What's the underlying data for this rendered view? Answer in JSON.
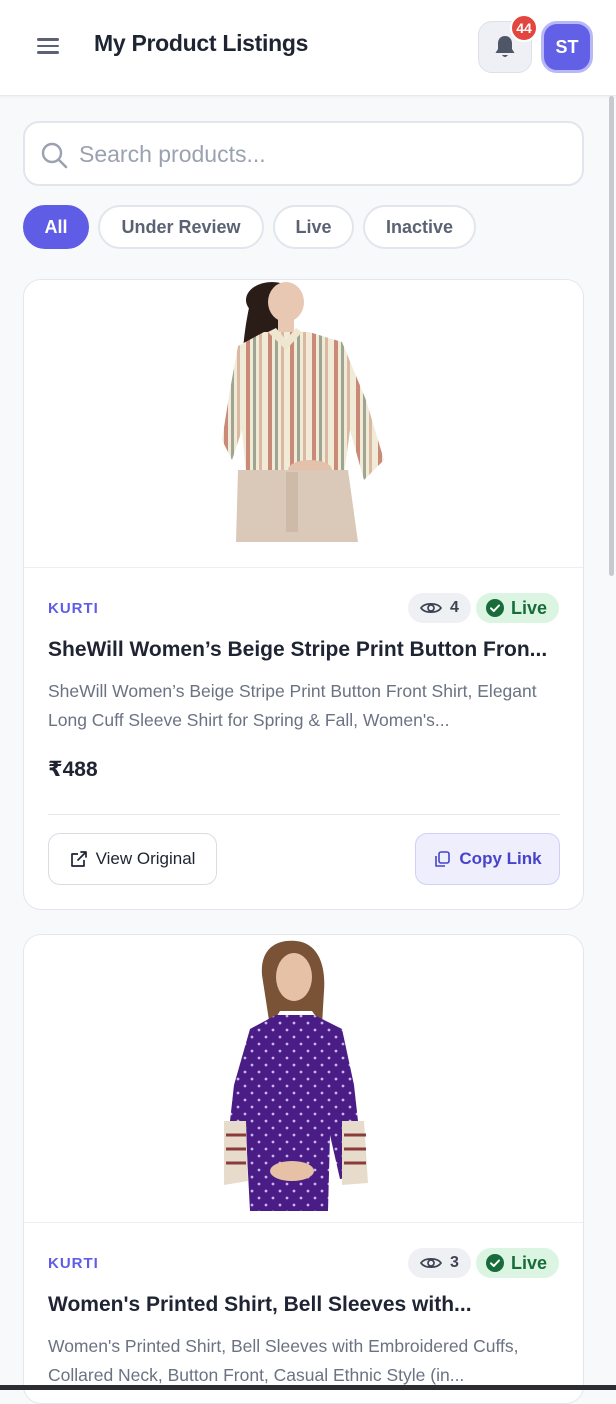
{
  "header": {
    "title": "My Product Listings",
    "menu_icon": "hamburger-menu-icon",
    "notification_count": "44",
    "avatar_initials": "ST"
  },
  "search": {
    "placeholder": "Search products..."
  },
  "filters": [
    {
      "label": "All",
      "active": true
    },
    {
      "label": "Under Review",
      "active": false
    },
    {
      "label": "Live",
      "active": false
    },
    {
      "label": "Inactive",
      "active": false
    }
  ],
  "products": [
    {
      "category": "KURTI",
      "views": "4",
      "status": "Live",
      "title": "SheWill Women’s Beige Stripe Print Button Fron...",
      "description": "SheWill Women’s Beige Stripe Print Button Front Shirt, Elegant Long Cuff Sleeve Shirt for Spring & Fall, Women's...",
      "price": "₹488",
      "view_original_label": "View Original",
      "copy_link_label": "Copy Link"
    },
    {
      "category": "KURTI",
      "views": "3",
      "status": "Live",
      "title": "Women's Printed Shirt, Bell Sleeves with...",
      "description": "Women's Printed Shirt, Bell Sleeves with Embroidered Cuffs, Collared Neck, Button Front, Casual Ethnic Style (in..."
    }
  ],
  "colors": {
    "accent": "#5f5ce6",
    "live_bg": "#dcf5e3",
    "live_text": "#176c3a",
    "badge": "#e2463f"
  }
}
